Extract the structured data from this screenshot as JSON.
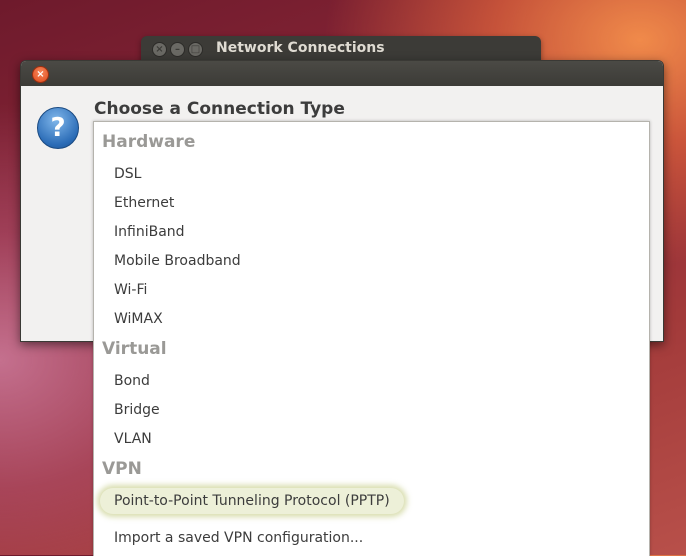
{
  "background_window": {
    "title": "Network Connections",
    "controls": [
      "close",
      "minimize",
      "maximize"
    ]
  },
  "dialog": {
    "heading": "Choose a Connection Type",
    "icon": "question-icon"
  },
  "list": {
    "groups": [
      {
        "header": "Hardware",
        "items": [
          "DSL",
          "Ethernet",
          "InfiniBand",
          "Mobile Broadband",
          "Wi-Fi",
          "WiMAX"
        ]
      },
      {
        "header": "Virtual",
        "items": [
          "Bond",
          "Bridge",
          "VLAN"
        ]
      },
      {
        "header": "VPN",
        "items": [
          "Point-to-Point Tunneling Protocol (PPTP)",
          "Import a saved VPN configuration..."
        ]
      }
    ],
    "highlighted": "Point-to-Point Tunneling Protocol (PPTP)"
  },
  "colors": {
    "close_button": "#df4a1b",
    "titlebar": "#3c3b37",
    "highlight": "#edf0d8"
  }
}
